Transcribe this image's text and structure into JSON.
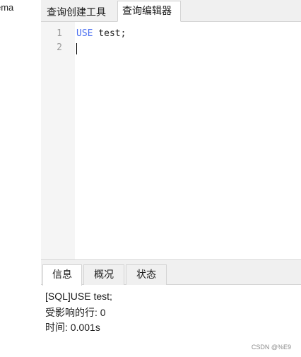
{
  "sidebar": {
    "clipped_text": "ema"
  },
  "top_tabs": [
    {
      "label": "查询创建工具"
    },
    {
      "label": "查询编辑器"
    }
  ],
  "editor": {
    "lines": [
      {
        "num": "1",
        "keyword": "USE",
        "rest": " test;"
      },
      {
        "num": "2",
        "keyword": "",
        "rest": ""
      }
    ],
    "keyword_color": "#4a6ef0"
  },
  "bottom_tabs": [
    {
      "label": "信息"
    },
    {
      "label": "概况"
    },
    {
      "label": "状态"
    }
  ],
  "messages": [
    "[SQL]USE test;",
    "受影响的行: 0",
    "时间: 0.001s"
  ],
  "watermark": "CSDN @%E9"
}
